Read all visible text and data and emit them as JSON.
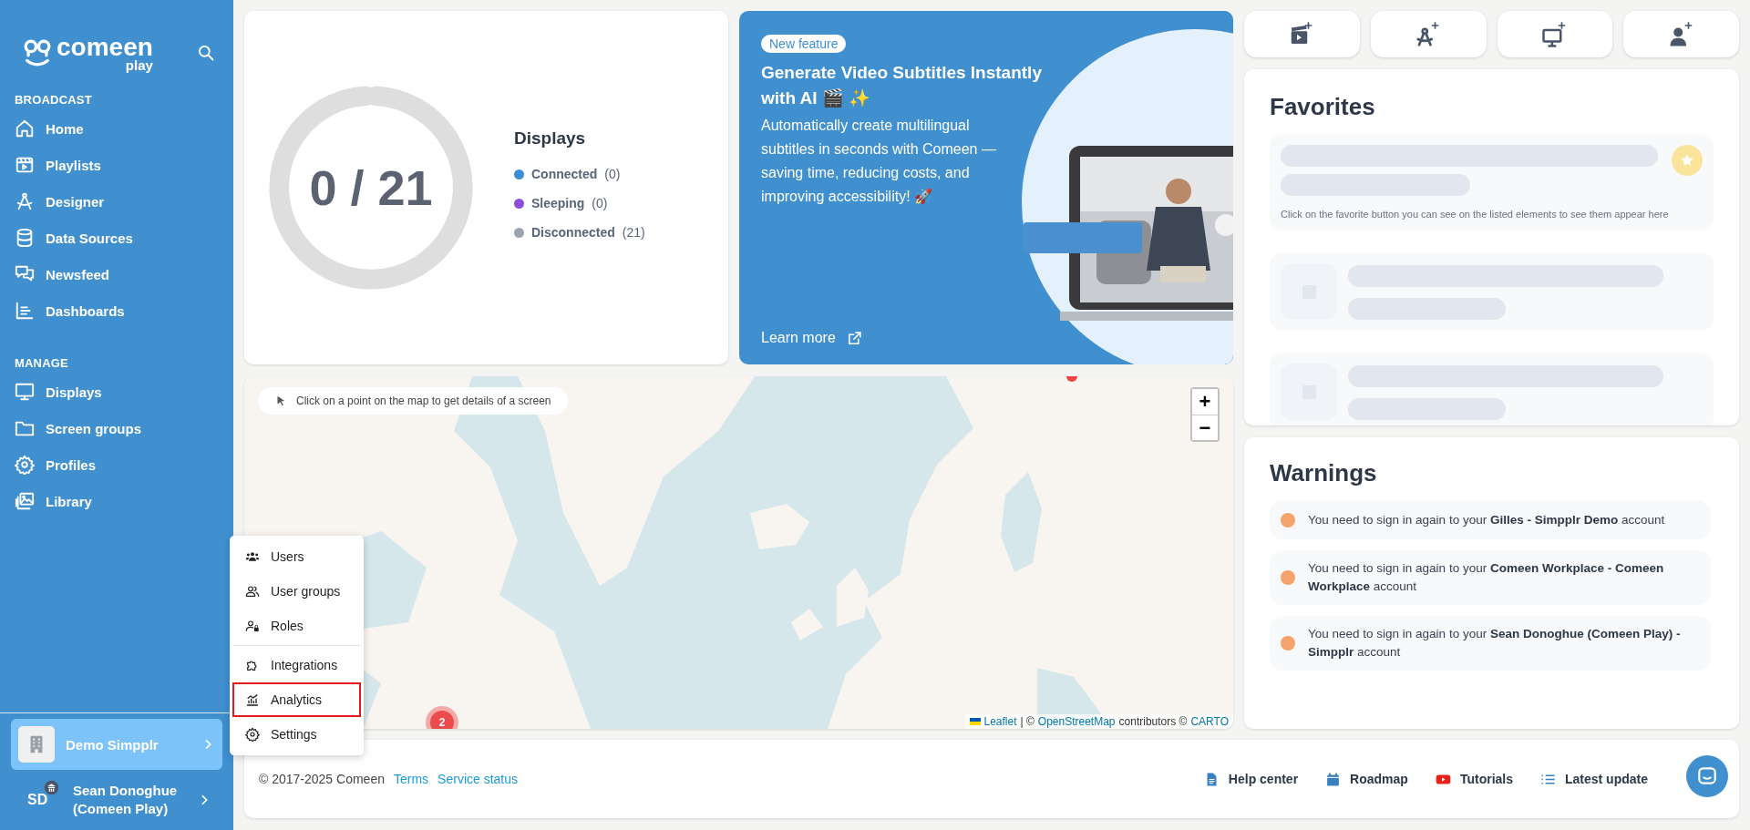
{
  "sidebar": {
    "logo": {
      "name": "comeen",
      "sub": "play"
    },
    "sections": [
      {
        "heading": "BROADCAST",
        "items": [
          {
            "label": "Home",
            "selected": false
          },
          {
            "label": "Playlists",
            "selected": false
          },
          {
            "label": "Designer",
            "selected": false
          },
          {
            "label": "Data Sources",
            "selected": false
          },
          {
            "label": "Newsfeed",
            "selected": false
          },
          {
            "label": "Dashboards",
            "selected": false
          }
        ]
      },
      {
        "heading": "MANAGE",
        "items": [
          {
            "label": "Displays",
            "selected": false
          },
          {
            "label": "Screen groups",
            "selected": false
          },
          {
            "label": "Profiles",
            "selected": false
          },
          {
            "label": "Library",
            "selected": false
          }
        ]
      }
    ],
    "organization": {
      "label": "Demo Simpplr",
      "selected": true
    },
    "user": {
      "initials": "SD",
      "name": "Sean Donoghue (Comeen Play)"
    }
  },
  "admin_menu": {
    "groups": [
      {
        "items": [
          {
            "label": "Users",
            "selected": false
          },
          {
            "label": "User groups",
            "selected": false
          },
          {
            "label": "Roles",
            "selected": false
          }
        ]
      },
      {
        "items": [
          {
            "label": "Integrations",
            "selected": false
          },
          {
            "label": "Analytics",
            "selected": true
          },
          {
            "label": "Settings",
            "selected": false
          }
        ]
      }
    ]
  },
  "displays_card": {
    "summary": "0 / 21",
    "title": "Displays",
    "legend": [
      {
        "label": "Connected",
        "count": "(0)",
        "color": "#3b8ed6"
      },
      {
        "label": "Sleeping",
        "count": "(0)",
        "color": "#8b4fd8"
      },
      {
        "label": "Disconnected",
        "count": "(21)",
        "color": "#9ba3ae"
      }
    ]
  },
  "feature_card": {
    "badge": "New feature",
    "title": "Generate Video Subtitles Instantly with AI 🎬 ✨",
    "body": "Automatically create multilingual subtitles in seconds with Comeen — saving time, reducing costs, and improving accessibility! 🚀",
    "link": "Learn more"
  },
  "map": {
    "hint": "Click on a point on the map to get details of a screen",
    "zoom_in": "+",
    "zoom_out": "−",
    "cluster": "2",
    "attribution": {
      "leaflet": "Leaflet",
      "separator": "| ©",
      "osm": "OpenStreetMap",
      "contributors": "contributors ©",
      "carto": "CARTO"
    }
  },
  "favorites": {
    "title": "Favorites",
    "hint": "Click on the favorite button you can see on the listed elements to see them appear here"
  },
  "warnings": {
    "title": "Warnings",
    "items": [
      {
        "text": "You need to sign in again to your **Gilles - Simpplr Demo** account"
      },
      {
        "text": "You need to sign in again to your **Comeen Workplace - Comeen Workplace** account"
      },
      {
        "text": "You need to sign in again to your **Sean Donoghue (Comeen Play) - Simpplr** account"
      }
    ]
  },
  "footer": {
    "copyright": "© 2017-2025 Comeen",
    "links": [
      "Terms",
      "Service status"
    ],
    "resources": [
      "Help center",
      "Roadmap",
      "Tutorials",
      "Latest update"
    ]
  }
}
